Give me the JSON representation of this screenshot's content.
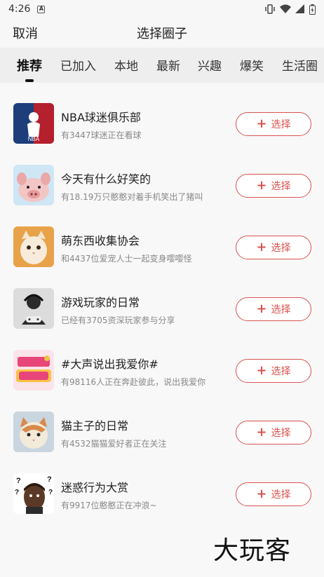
{
  "status_bar": {
    "time": "4:26",
    "notification_letter": "A",
    "icons": [
      "vibrate-icon",
      "wifi-icon",
      "signal-icon",
      "battery-icon"
    ]
  },
  "header": {
    "cancel_label": "取消",
    "title": "选择圈子"
  },
  "tabs": [
    {
      "label": "推荐",
      "active": true
    },
    {
      "label": "已加入",
      "active": false
    },
    {
      "label": "本地",
      "active": false
    },
    {
      "label": "最新",
      "active": false
    },
    {
      "label": "兴趣",
      "active": false
    },
    {
      "label": "爆笑",
      "active": false
    },
    {
      "label": "生活圈",
      "active": false
    }
  ],
  "circles": [
    {
      "name": "NBA球迷俱乐部",
      "desc": "有3447球迷正在看球",
      "button": "选择",
      "avatar_icon": "nba-logo-icon"
    },
    {
      "name": "今天有什么好笑的",
      "desc": "有18.19万只憨憨对着手机笑出了猪叫",
      "button": "选择",
      "avatar_icon": "pig-icon"
    },
    {
      "name": "萌东西收集协会",
      "desc": "和4437位爱宠人士一起变身嘤嘤怪",
      "button": "选择",
      "avatar_icon": "kitten-icon"
    },
    {
      "name": "游戏玩家的日常",
      "desc": "已经有3705资深玩家参与分享",
      "button": "选择",
      "avatar_icon": "gamer-icon"
    },
    {
      "name": "#大声说出我爱你#",
      "desc": "有98116人正在奔赴彼此，说出我爱你",
      "button": "选择",
      "avatar_icon": "love-text-icon"
    },
    {
      "name": "猫主子的日常",
      "desc": "有4532猫猫爱好者正在关注",
      "button": "选择",
      "avatar_icon": "cat-icon"
    },
    {
      "name": "迷惑行为大赏",
      "desc": "有9917位憨憨正在冲浪~",
      "button": "选择",
      "avatar_icon": "confused-face-icon"
    }
  ],
  "watermark": "大玩客",
  "colors": {
    "accent": "#d9534f",
    "tab_bar_bg": "#eeeeee"
  }
}
